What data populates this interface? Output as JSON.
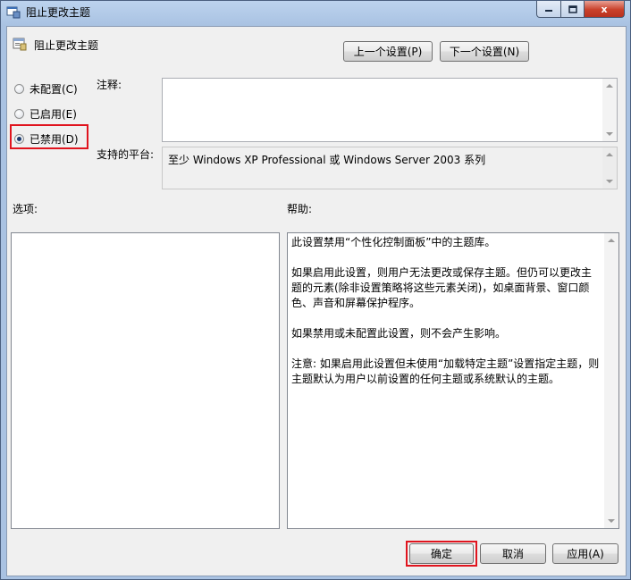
{
  "window": {
    "title": "阻止更改主题",
    "close_glyph": "x"
  },
  "policy": {
    "name": "阻止更改主题"
  },
  "nav": {
    "prev_label": "上一个设置(P)",
    "next_label": "下一个设置(N)"
  },
  "state": {
    "options": [
      {
        "label": "未配置(C)",
        "checked": false
      },
      {
        "label": "已启用(E)",
        "checked": false
      },
      {
        "label": "已禁用(D)",
        "checked": true
      }
    ]
  },
  "comment": {
    "label": "注释:",
    "value": ""
  },
  "platform": {
    "label": "支持的平台:",
    "value": "至少 Windows XP Professional 或 Windows Server 2003 系列"
  },
  "options_pane": {
    "label": "选项:"
  },
  "help_pane": {
    "label": "帮助:",
    "paragraphs": [
      "此设置禁用“个性化控制面板”中的主题库。",
      "如果启用此设置，则用户无法更改或保存主题。但仍可以更改主题的元素(除非设置策略将这些元素关闭)，如桌面背景、窗口颜色、声音和屏幕保护程序。",
      "如果禁用或未配置此设置，则不会产生影响。",
      "注意: 如果启用此设置但未使用“加载特定主题”设置指定主题，则主题默认为用户以前设置的任何主题或系统默认的主题。"
    ]
  },
  "footer": {
    "ok_label": "确定",
    "cancel_label": "取消",
    "apply_label": "应用(A)"
  },
  "colors": {
    "highlight": "#e0141e",
    "title_bar": "#a9c2e2",
    "close_button": "#c9402a"
  }
}
